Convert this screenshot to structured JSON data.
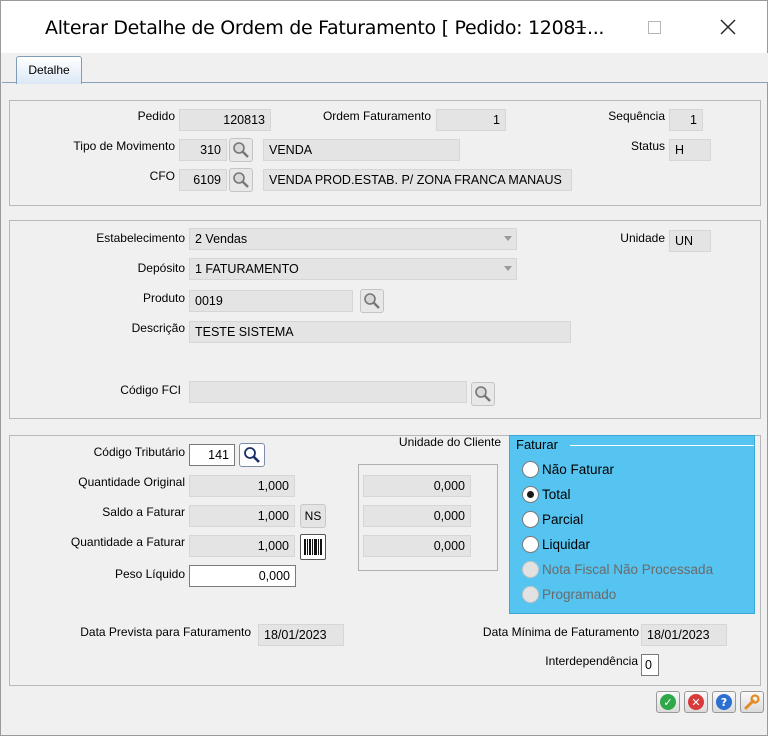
{
  "window": {
    "title": "Alterar Detalhe de Ordem de Faturamento [ Pedido: 12081..."
  },
  "tabs": [
    {
      "label": "Detalhe"
    }
  ],
  "header": {
    "pedido_label": "Pedido",
    "pedido_value": "120813",
    "ordem_label": "Ordem Faturamento",
    "ordem_value": "1",
    "sequencia_label": "Sequência",
    "sequencia_value": "1",
    "tipo_mov_label": "Tipo de Movimento",
    "tipo_mov_code": "310",
    "tipo_mov_desc": "VENDA",
    "status_label": "Status",
    "status_value": "H",
    "cfo_label": "CFO",
    "cfo_code": "6109",
    "cfo_desc": "VENDA PROD.ESTAB. P/ ZONA FRANCA MANAUS"
  },
  "product": {
    "estabelecimento_label": "Estabelecimento",
    "estabelecimento_value": "2 Vendas",
    "unidade_label": "Unidade",
    "unidade_value": "UN",
    "deposito_label": "Depósito",
    "deposito_value": "1 FATURAMENTO",
    "produto_label": "Produto",
    "produto_value": "0019",
    "descricao_label": "Descrição",
    "descricao_value": "TESTE SISTEMA",
    "fci_label": "Código FCI",
    "fci_value": ""
  },
  "quantities": {
    "cod_trib_label": "Código Tributário",
    "cod_trib_value": "141",
    "unidade_cliente_label": "Unidade do Cliente",
    "qtd_original_label": "Quantidade Original",
    "qtd_original_value": "1,000",
    "qtd_original_cliente": "0,000",
    "saldo_label": "Saldo a Faturar",
    "saldo_value": "1,000",
    "saldo_btn": "NS",
    "saldo_cliente": "0,000",
    "qtd_faturar_label": "Quantidade a Faturar",
    "qtd_faturar_value": "1,000",
    "qtd_faturar_cliente": "0,000",
    "peso_label": "Peso Líquido",
    "peso_value": "0,000",
    "data_prevista_label": "Data Prevista para Faturamento",
    "data_prevista_value": "18/01/2023",
    "data_minima_label": "Data Mínima de Faturamento",
    "data_minima_value": "18/01/2023",
    "interdep_label": "Interdependência",
    "interdep_value": "0"
  },
  "faturar": {
    "title": "Faturar",
    "options": [
      {
        "label": "Não Faturar",
        "selected": false,
        "enabled": true
      },
      {
        "label": "Total",
        "selected": true,
        "enabled": true
      },
      {
        "label": "Parcial",
        "selected": false,
        "enabled": true
      },
      {
        "label": "Liquidar",
        "selected": false,
        "enabled": true
      },
      {
        "label": "Nota Fiscal Não Processada",
        "selected": false,
        "enabled": false
      },
      {
        "label": "Programado",
        "selected": false,
        "enabled": false
      }
    ]
  },
  "colors": {
    "faturar_bg": "#56c4f0",
    "ok": "#2fa84a",
    "cancel": "#d63a3a",
    "help": "#2c6fd1",
    "tools": "#e58a1f"
  },
  "icons": {
    "search": "magnifier-icon",
    "barcode": "barcode-icon",
    "ok": "check-icon",
    "cancel": "cancel-icon",
    "help": "help-icon",
    "tools": "wrench-icon"
  }
}
